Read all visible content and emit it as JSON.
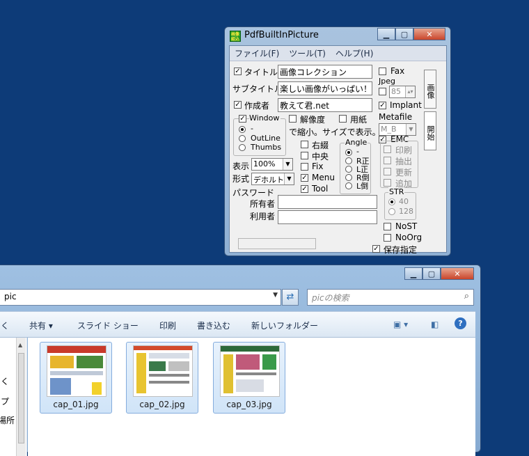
{
  "pdfwin": {
    "title": "PdfBuiltInPicture",
    "icon_text": "画像\n組込",
    "menu": [
      "ファイル(F)",
      "ツール(T)",
      "ヘルプ(H)"
    ],
    "title_label": "タイトル",
    "title_value": "画像コレクション",
    "subtitle_label": "サブタイトル",
    "subtitle_value": "楽しい画像がいっぱい！",
    "author_label": "作成者",
    "author_value": "教えて君.net",
    "fax_label": "Fax",
    "jpeg_label": "Jpeg",
    "jpeg_quality": "85",
    "implant_label": "Implant",
    "metafile_label": "Metafile",
    "metafile_value": "M_B",
    "emc_label": "EMC",
    "print_label": "印刷",
    "extract_label": "抽出",
    "update_label": "更新",
    "append_label": "追加",
    "str_label": "STR",
    "str_40": "40",
    "str_128": "128",
    "nost_label": "NoST",
    "noorg_label": "NoOrg",
    "save_spec_label": "保存指定",
    "window_label": "Window",
    "radio_dash": "-",
    "outline_label": "OutLine",
    "thumbs_label": "Thumbs",
    "resolution_label": "解像度",
    "paper_label": "用紙",
    "shrink_note": "で縮小。サイズで表示。",
    "right_bind": "右綴",
    "center": "中央",
    "fix": "Fix",
    "menu_opt": "Menu",
    "tool_opt": "Tool",
    "angle_label": "Angle",
    "angle_dash": "-",
    "angle_r_pos": "R正",
    "angle_l_pos": "L正",
    "angle_r_inv": "R倒",
    "angle_l_inv": "L倒",
    "display_label": "表示",
    "display_value": "100%",
    "format_label": "形式",
    "format_value": "デホルト",
    "password_label": "パスワード",
    "owner_label": "所有者",
    "user_label": "利用者",
    "tab_image": "画像",
    "tab_open": "開始"
  },
  "explorer": {
    "address": "pic",
    "search_placeholder": "picの検索",
    "toolbar": [
      "く",
      "共有 ▾",
      "スライド ショー",
      "印刷",
      "書き込む",
      "新しいフォルダー"
    ],
    "nav_items": [
      "く",
      "プ",
      "た場所"
    ],
    "files": [
      "cap_01.jpg",
      "cap_02.jpg",
      "cap_03.jpg"
    ]
  },
  "colors": {
    "desktop": "#0d3b78",
    "close_button": "#c9452b",
    "accent_selection": "#84acdd"
  }
}
